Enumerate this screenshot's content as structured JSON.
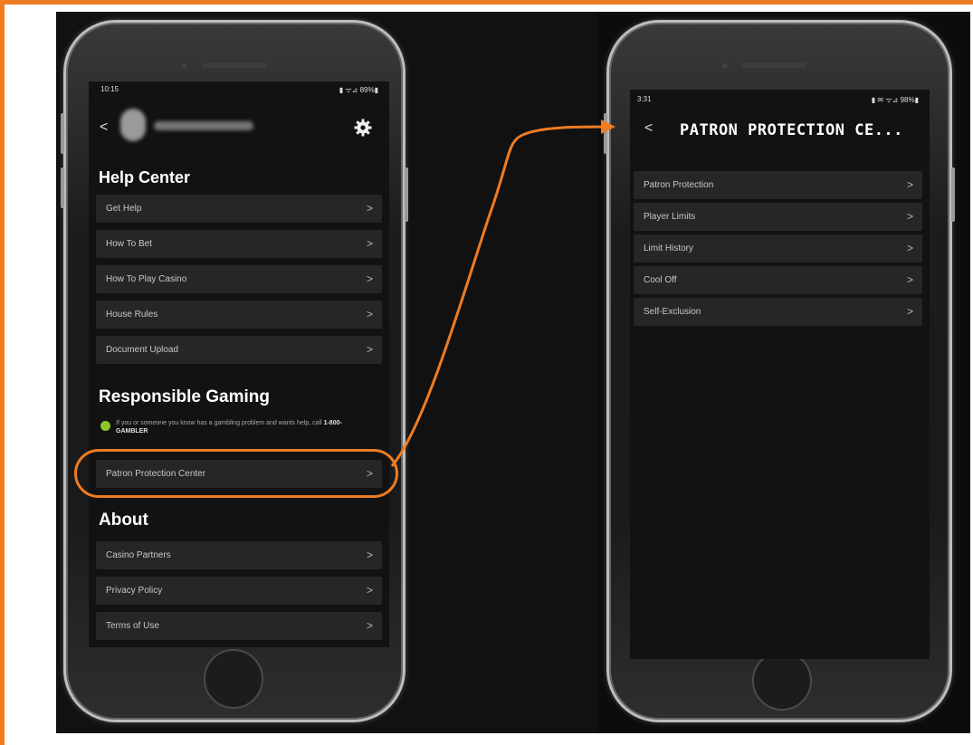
{
  "colors": {
    "accent": "#ee7c22",
    "row_bg": "#262626",
    "screen_bg": "#121212"
  },
  "left_phone": {
    "status_time": "10:15",
    "status_icons": "▮ ᯤ⊿ 89%▮",
    "back_icon": "chevron-left-icon",
    "settings_icon": "gear-icon",
    "help_center": {
      "title": "Help Center",
      "items": [
        "Get Help",
        "How To Bet",
        "How To Play Casino",
        "House Rules",
        "Document Upload"
      ]
    },
    "responsible_gaming": {
      "title": "Responsible Gaming",
      "notice_prefix": "If you or someone you know has a gambling problem and wants help, call ",
      "hotline": "1-800-GAMBLER",
      "item": "Patron Protection Center"
    },
    "about": {
      "title": "About",
      "items": [
        "Casino Partners",
        "Privacy Policy",
        "Terms of Use"
      ]
    }
  },
  "right_phone": {
    "status_time": "3:31",
    "status_icons": "▮ ✉ ᯤ⊿ 98%▮",
    "title": "PATRON PROTECTION CE...",
    "items": [
      "Patron Protection",
      "Player Limits",
      "Limit History",
      "Cool Off",
      "Self-Exclusion"
    ]
  },
  "chevron": ">",
  "back": "<"
}
